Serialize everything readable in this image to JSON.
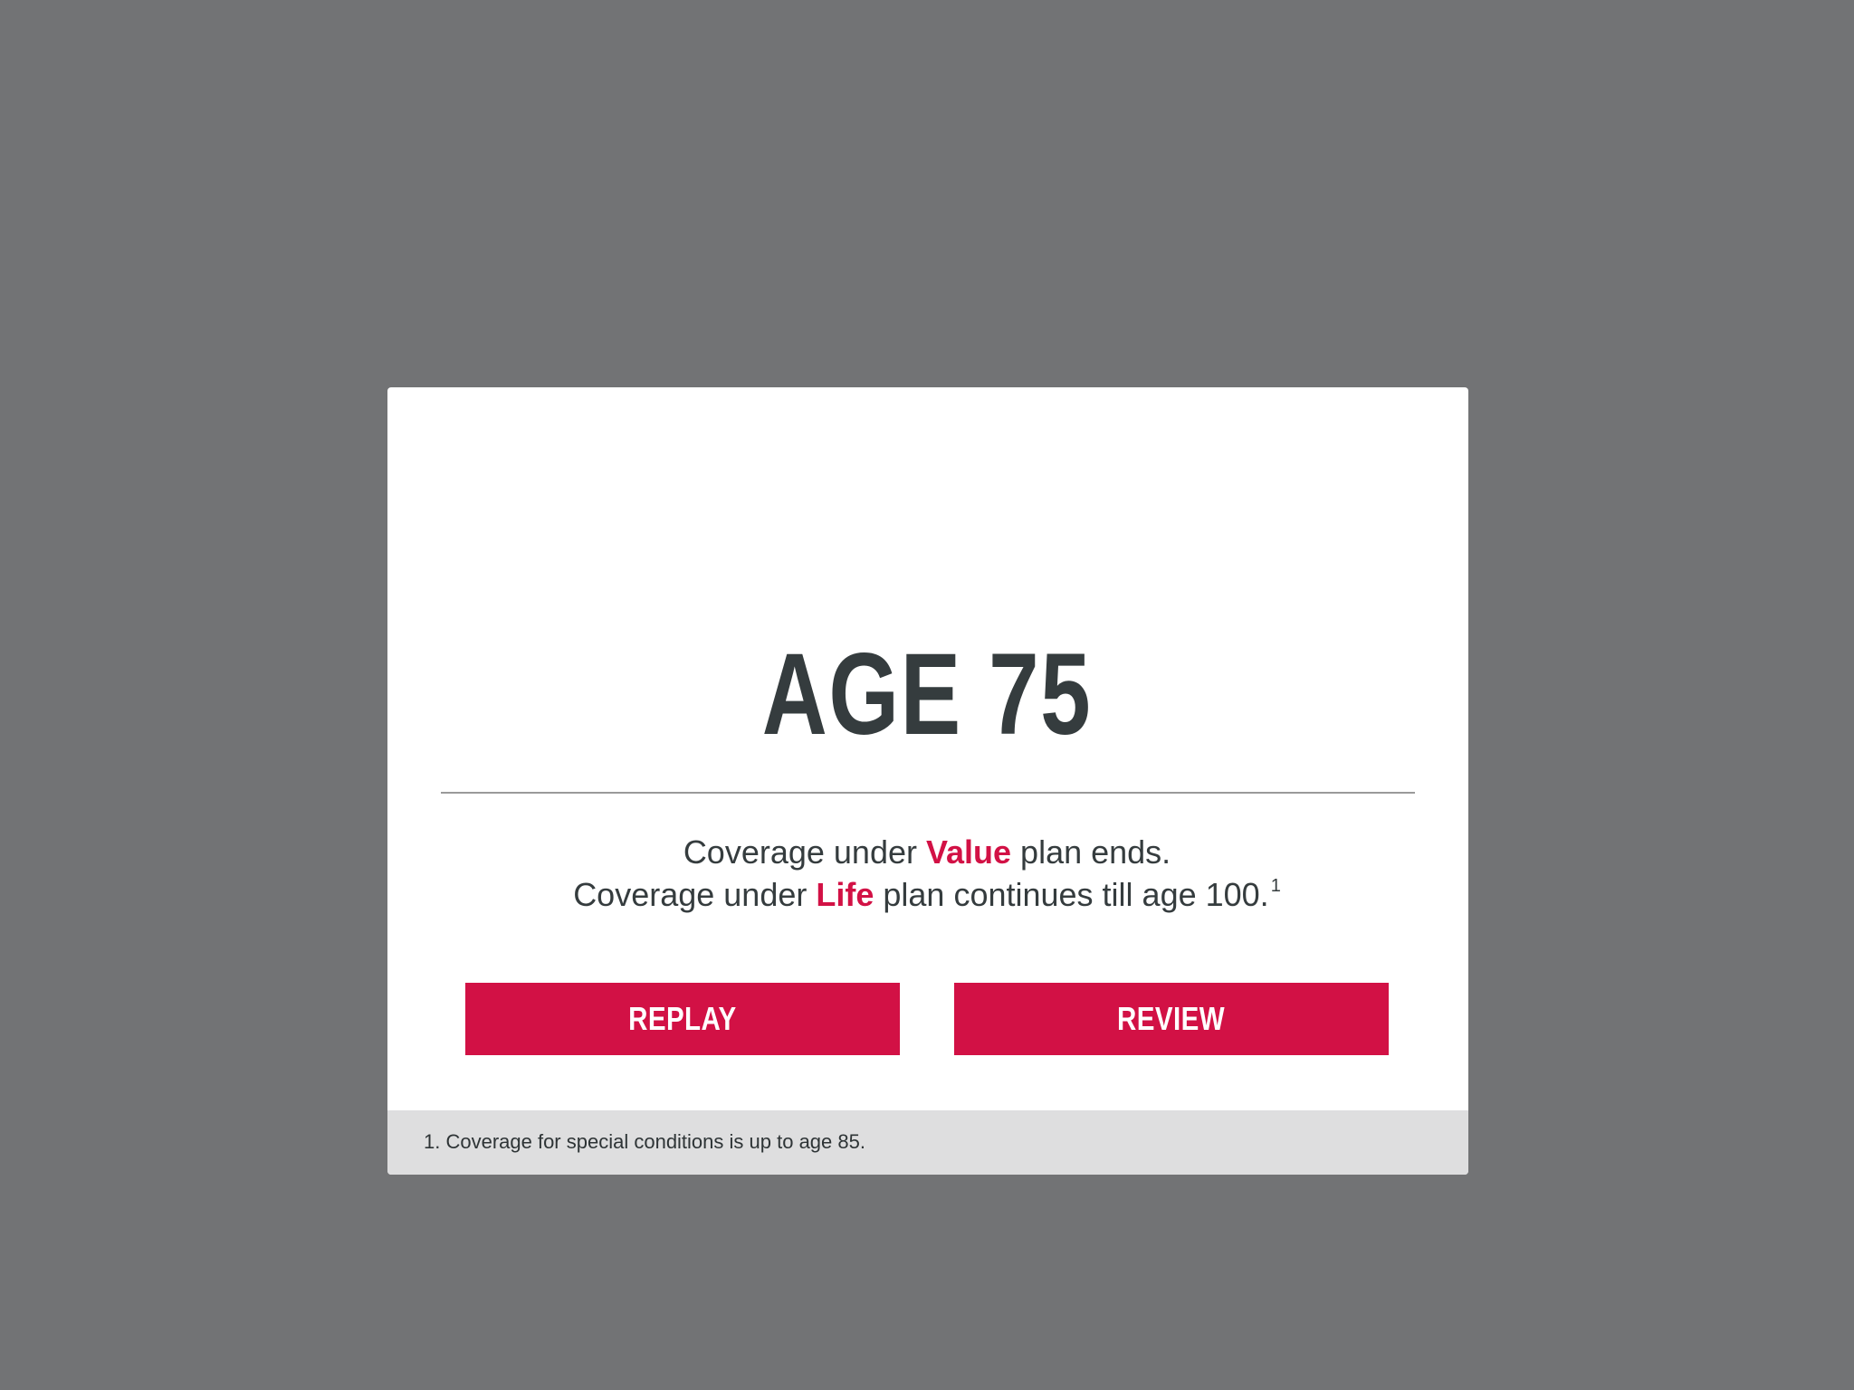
{
  "colors": {
    "backdrop": "#727375",
    "accent": "#d21145",
    "text": "#353c3e",
    "footer_bg": "#dededf"
  },
  "dialog": {
    "title": "AGE 75",
    "line1": {
      "before": "Coverage under ",
      "highlight": "Value",
      "after": " plan ends."
    },
    "line2": {
      "before": "Coverage under ",
      "highlight": "Life",
      "after": " plan continues till age 100.",
      "footnote_marker": "1"
    },
    "buttons": {
      "replay_label": "REPLAY",
      "review_label": "REVIEW"
    },
    "footnote": "1. Coverage for special conditions is up to age 85."
  }
}
